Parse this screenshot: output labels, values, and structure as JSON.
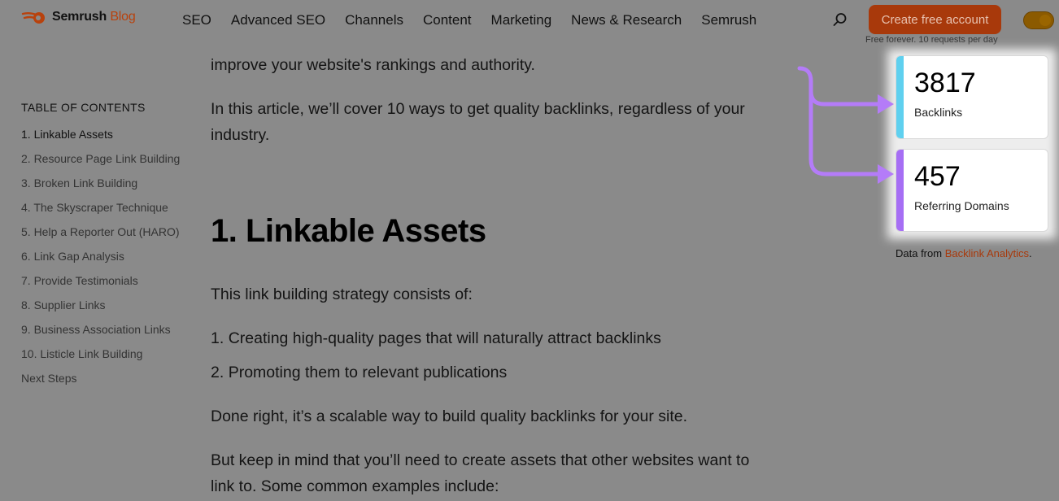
{
  "header": {
    "brand": "Semrush",
    "brand_suffix": "Blog",
    "nav": [
      "SEO",
      "Advanced SEO",
      "Channels",
      "Content",
      "Marketing",
      "News & Research",
      "Semrush"
    ],
    "cta_label": "Create free account",
    "cta_note": "Free forever. 10 requests per day"
  },
  "toc": {
    "heading": "TABLE OF CONTENTS",
    "items": [
      "1. Linkable Assets",
      "2. Resource Page Link Building",
      "3. Broken Link Building",
      "4. The Skyscraper Technique",
      "5. Help a Reporter Out (HARO)",
      "6. Link Gap Analysis",
      "7. Provide Testimonials",
      "8. Supplier Links",
      "9. Business Association Links",
      "10. Listicle Link Building",
      "Next Steps"
    ]
  },
  "article": {
    "intro_tail": "improve your website's rankings and authority.",
    "intro": "In this article, we’ll cover 10 ways to get quality backlinks, regardless of your industry.",
    "section_title": "1. Linkable Assets",
    "strategy_intro": "This link building strategy consists of:",
    "steps": [
      "Creating high-quality pages that will naturally attract backlinks",
      "Promoting them to relevant publications"
    ],
    "done_right": "Done right, it’s a scalable way to build quality backlinks for your site.",
    "keep_in_mind": "But keep in mind that you’ll need to create assets that other websites want to link to. Some common examples include:"
  },
  "stats": {
    "backlinks_value": "3817",
    "backlinks_label": "Backlinks",
    "domains_value": "457",
    "domains_label": "Referring Domains",
    "data_from_prefix": "Data from ",
    "data_from_link": "Backlink Analytics",
    "data_from_suffix": "."
  },
  "colors": {
    "accent": "#a8390b",
    "backlinks_bar": "#5fd0ef",
    "domains_bar": "#a66ef4",
    "arrow": "#b47cf8"
  }
}
